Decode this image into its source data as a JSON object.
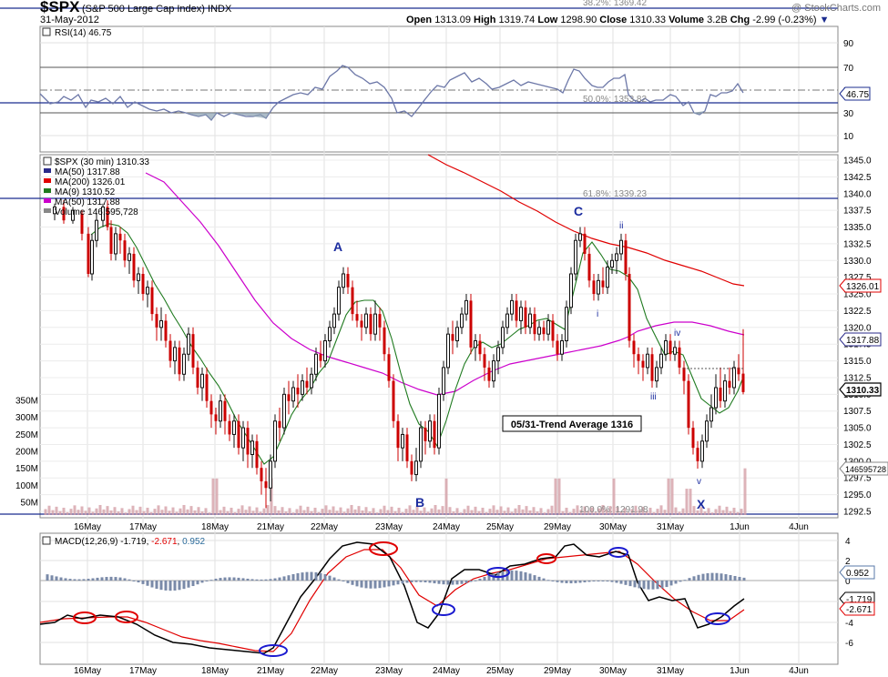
{
  "header": {
    "symbol": "$SPX",
    "name": "(S&P 500 Large Cap Index)",
    "exchange": "INDX",
    "date": "31-May-2012",
    "open_label": "Open",
    "open": "1313.09",
    "high_label": "High",
    "high": "1319.74",
    "low_label": "Low",
    "low": "1298.90",
    "close_label": "Close",
    "close": "1310.33",
    "volume_label": "Volume",
    "volume": "3.2B",
    "chg_label": "Chg",
    "chg": "-2.99 (-0.23%)",
    "watermark": "@ StockCharts.com"
  },
  "colors": {
    "up": "#111111",
    "down": "#cc0000",
    "ma50_blue": "#2a2a8a",
    "ma200": "#e00000",
    "ma9": "#1f7a1f",
    "ma50_magenta": "#cc00cc",
    "rsi": "#6d78a8",
    "macd": "#000000",
    "signal": "#e00000",
    "hist": "#7a8aa8",
    "vol_up": "#b0b0b0",
    "vol_down": "#d4a0a8",
    "fib": "#888888",
    "circle_red": "#e00000",
    "circle_blue": "#1a1ad0"
  },
  "rsi_panel": {
    "label": "RSI(14) 46.75",
    "last": "46.75",
    "ticks": [
      "90",
      "70",
      "50",
      "30",
      "10"
    ],
    "fib_382": "38.2%: 1369.42",
    "fib_500": "50.0%: 1353.82"
  },
  "price_panel": {
    "legend": [
      "$SPX (30 min) 1310.33",
      "MA(50) 1317.88",
      "MA(200) 1326.01",
      "MA(9) 1310.52",
      "MA(50) 1317.88",
      "Volume 146,595,728"
    ],
    "fib_618": "61.8%: 1339.23",
    "fib_1000": "100.0%: 1291.98",
    "trend_box": "05/31-Trend Average 1316",
    "wave_labels": [
      "A",
      "B",
      "C",
      "X",
      "i",
      "ii",
      "iii",
      "iv",
      "v"
    ],
    "price_ticks": [
      "1345.0",
      "1342.5",
      "1340.0",
      "1337.5",
      "1335.0",
      "1332.5",
      "1330.0",
      "1327.5",
      "1325.0",
      "1322.5",
      "1320.0",
      "1317.5",
      "1315.0",
      "1312.5",
      "1310.0",
      "1307.5",
      "1305.0",
      "1302.5",
      "1300.0",
      "1297.5",
      "1295.0",
      "1292.5"
    ],
    "volume_ticks": [
      "350M",
      "300M",
      "250M",
      "200M",
      "150M",
      "100M",
      "50M"
    ],
    "tag_ma200": "1326.01",
    "tag_ma50": "1317.88",
    "tag_close": "1310.33",
    "tag_volume": "146595728"
  },
  "macd_panel": {
    "label_prefix": "MACD(12,26,9)",
    "macd": "-1.719",
    "signal": "-2.671",
    "hist": "0.952",
    "ticks": [
      "4",
      "2",
      "0",
      "-2",
      "-4",
      "-6"
    ],
    "tag_hist": "0.952",
    "tag_macd": "-1.719",
    "tag_signal": "-2.671"
  },
  "x_axis": [
    "16May",
    "17May",
    "18May",
    "21May",
    "22May",
    "23May",
    "24May",
    "25May",
    "29May",
    "30May",
    "31May",
    "1Jun",
    "4Jun"
  ],
  "chart_data": {
    "type": "line",
    "title": "$SPX (S&P 500 Large Cap Index) INDX 30 min",
    "x": [
      "16May",
      "17May",
      "18May",
      "21May",
      "22May",
      "23May",
      "24May",
      "25May",
      "29May",
      "30May",
      "31May"
    ],
    "close_approx": [
      1327.5,
      1316.0,
      1300.0,
      1310.0,
      1326.0,
      1304.0,
      1318.0,
      1318.0,
      1330.0,
      1313.0,
      1310.33
    ],
    "series": [
      {
        "name": "MA(200)",
        "last": 1326.01
      },
      {
        "name": "MA(50)",
        "last": 1317.88
      },
      {
        "name": "MA(9)",
        "last": 1310.52
      },
      {
        "name": "RSI(14)",
        "last": 46.75
      },
      {
        "name": "MACD(12,26,9)",
        "last": -1.719
      },
      {
        "name": "Signal",
        "last": -2.671
      },
      {
        "name": "Histogram",
        "last": 0.952
      }
    ],
    "ylim": [
      1291,
      1346
    ],
    "grid": true,
    "legend": "top-left"
  }
}
